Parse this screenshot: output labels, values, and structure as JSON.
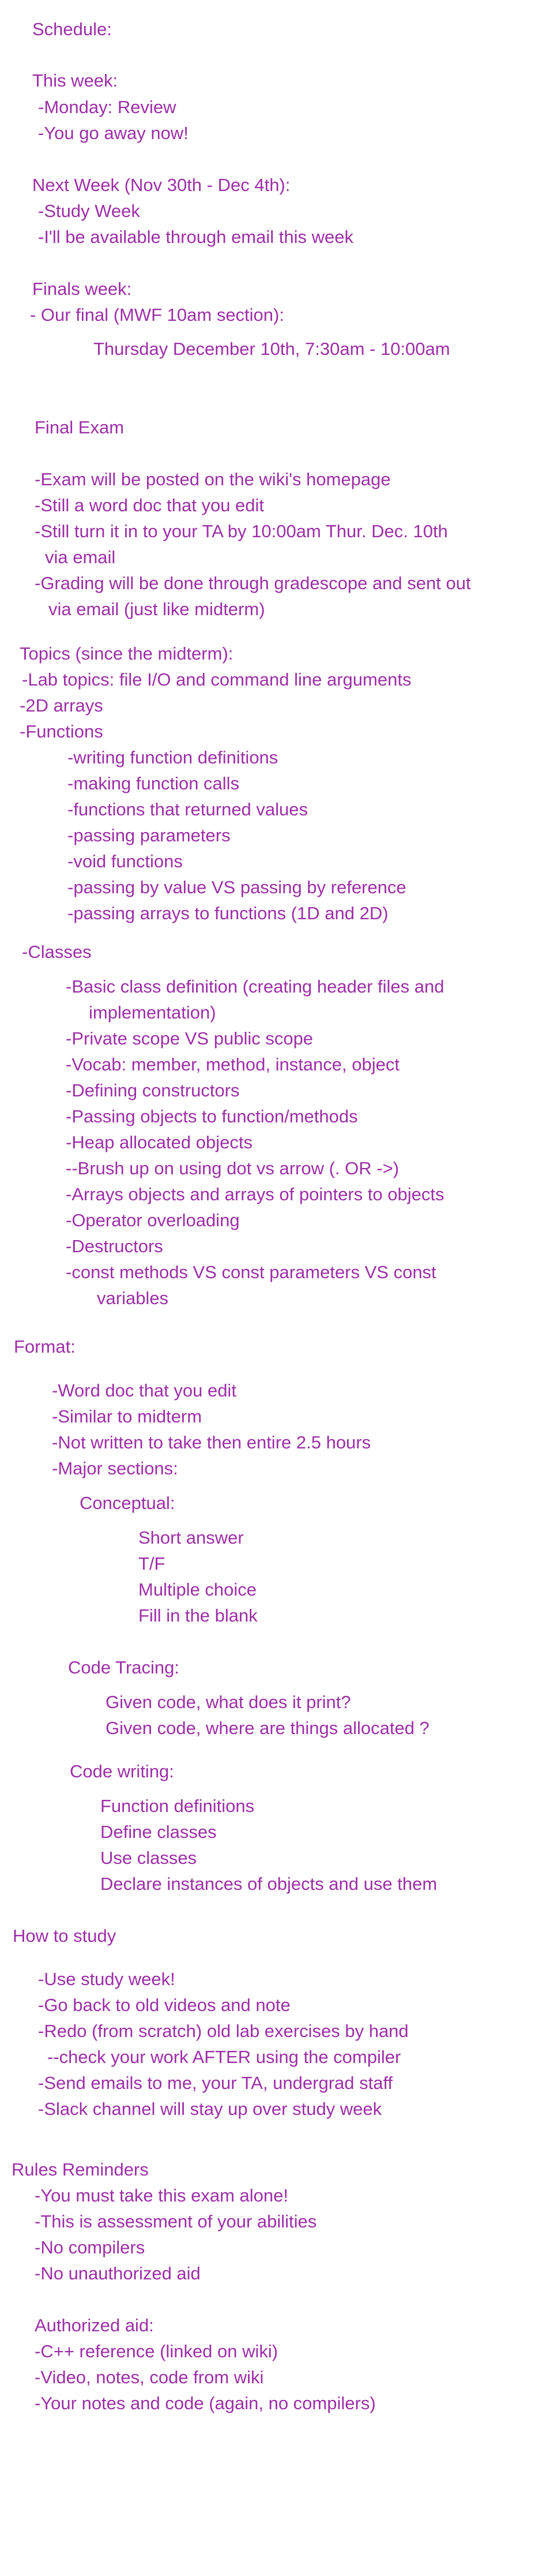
{
  "text_color": "#9c2fa6",
  "schedule": {
    "title": "Schedule:",
    "this_week": {
      "heading": "This week:",
      "items": [
        "-Monday: Review",
        "-You go away now!"
      ]
    },
    "next_week": {
      "heading": "Next Week (Nov 30th - Dec 4th):",
      "items": [
        "-Study Week",
        "-I'll be available through email this week"
      ]
    },
    "finals_week": {
      "heading": "Finals week:",
      "item": "- Our final (MWF 10am section):",
      "date": "Thursday December 10th, 7:30am - 10:00am"
    }
  },
  "final_exam": {
    "title": "Final Exam",
    "items": [
      "-Exam will be posted on the wiki's homepage",
      "-Still a word doc that you edit",
      "-Still turn it in to your TA by 10:00am Thur. Dec. 10th",
      "via email",
      "-Grading will be done through gradescope and sent out",
      "via email (just like midterm)"
    ]
  },
  "topics": {
    "title": "Topics (since the midterm):",
    "lab_topics": "-Lab topics: file I/O and command line arguments",
    "arrays_2d": "-2D arrays",
    "functions": {
      "heading": "-Functions",
      "items": [
        "-writing function definitions",
        "-making function calls",
        "-functions that returned values",
        "-passing parameters",
        "-void functions",
        "-passing by value VS passing by reference",
        "-passing arrays to functions (1D and 2D)"
      ]
    },
    "classes": {
      "heading": "-Classes",
      "items": [
        "-Basic class definition (creating header files and",
        "implementation)",
        "-Private scope VS public scope",
        "-Vocab: member, method, instance, object",
        "-Defining constructors",
        "-Passing objects to function/methods",
        "-Heap allocated objects",
        "--Brush up on using dot vs arrow (. OR ->)",
        "-Arrays objects and arrays of pointers to objects",
        "-Operator overloading",
        "-Destructors",
        "-const methods VS const parameters VS const",
        "variables"
      ]
    }
  },
  "format": {
    "title": "Format:",
    "items": [
      "-Word doc that you edit",
      "-Similar to midterm",
      "-Not written to take then entire 2.5 hours",
      "-Major sections:"
    ],
    "conceptual": {
      "heading": "Conceptual:",
      "items": [
        "Short answer",
        "T/F",
        "Multiple choice",
        "Fill in the blank"
      ]
    },
    "code_tracing": {
      "heading": "Code Tracing:",
      "items": [
        "Given code, what does it print?",
        "Given code, where are things allocated ?"
      ]
    },
    "code_writing": {
      "heading": "Code writing:",
      "items": [
        "Function definitions",
        "Define classes",
        "Use classes",
        "Declare instances of objects and use them"
      ]
    }
  },
  "how_to_study": {
    "title": "How to study",
    "items": [
      "-Use study week!",
      "-Go back to old videos and note",
      "-Redo (from scratch) old lab exercises by hand",
      "--check your work AFTER using the compiler",
      "-Send emails to me, your TA, undergrad staff",
      "-Slack channel will stay up over study week"
    ]
  },
  "rules": {
    "title": "Rules Reminders",
    "items": [
      "-You must take this exam alone!",
      "-This is assessment of your abilities",
      "-No compilers",
      "-No unauthorized aid"
    ],
    "authorized": {
      "heading": "Authorized aid:",
      "items": [
        "-C++ reference (linked on wiki)",
        "-Video, notes, code from wiki",
        "-Your notes and code (again, no compilers)"
      ]
    }
  }
}
